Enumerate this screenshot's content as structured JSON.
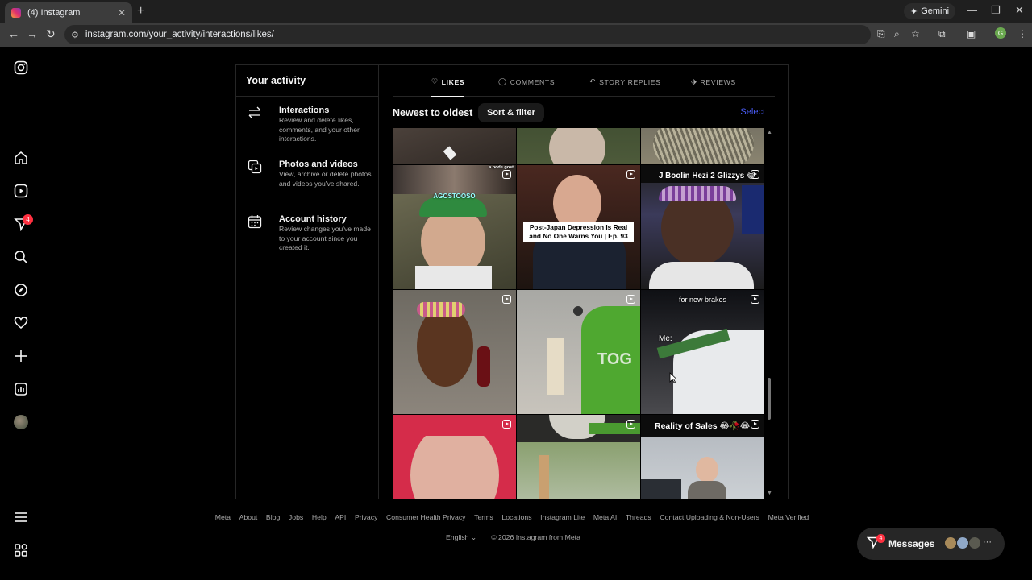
{
  "browser": {
    "tab_title": "(4) Instagram",
    "url": "instagram.com/your_activity/interactions/likes/",
    "gemini_label": "Gemini",
    "profile_initial": "G"
  },
  "nav": {
    "notifications_badge": "4"
  },
  "sidebar": {
    "title": "Your activity",
    "items": [
      {
        "label": "Interactions",
        "desc": "Review and delete likes, comments, and your other interactions.",
        "icon": "arrows-swap-icon"
      },
      {
        "label": "Photos and videos",
        "desc": "View, archive or delete photos and videos you've shared.",
        "icon": "media-icon"
      },
      {
        "label": "Account history",
        "desc": "Review changes you've made to your account since you created it.",
        "icon": "calendar-icon"
      }
    ]
  },
  "tabs": [
    {
      "label": "LIKES",
      "icon": "heart-icon",
      "active": true
    },
    {
      "label": "COMMENTS",
      "icon": "comment-icon",
      "active": false
    },
    {
      "label": "STORY REPLIES",
      "icon": "reply-icon",
      "active": false
    },
    {
      "label": "REVIEWS",
      "icon": "tag-icon",
      "active": false
    }
  ],
  "sort": {
    "title": "Newest to oldest",
    "button": "Sort & filter",
    "select": "Select"
  },
  "grid_captions": {
    "c1_small": "a pode gost",
    "c1_sticker": "AGOSTOOSO",
    "c2_box": "Post-Japan Depression Is Real and No One Warns You | Ep. 93",
    "c3_top": "J Boolin Hezi 2 Glizzys 😂",
    "c6_top": "for new brakes",
    "c6_me": "Me:",
    "c9_top": "Reality of Sales 😂🥀😂"
  },
  "footer": {
    "links": [
      "Meta",
      "About",
      "Blog",
      "Jobs",
      "Help",
      "API",
      "Privacy",
      "Consumer Health Privacy",
      "Terms",
      "Locations",
      "Instagram Lite",
      "Meta AI",
      "Threads",
      "Contact Uploading & Non-Users",
      "Meta Verified"
    ],
    "language": "English",
    "copyright": "© 2026 Instagram from Meta"
  },
  "messages": {
    "label": "Messages",
    "badge": "4"
  }
}
